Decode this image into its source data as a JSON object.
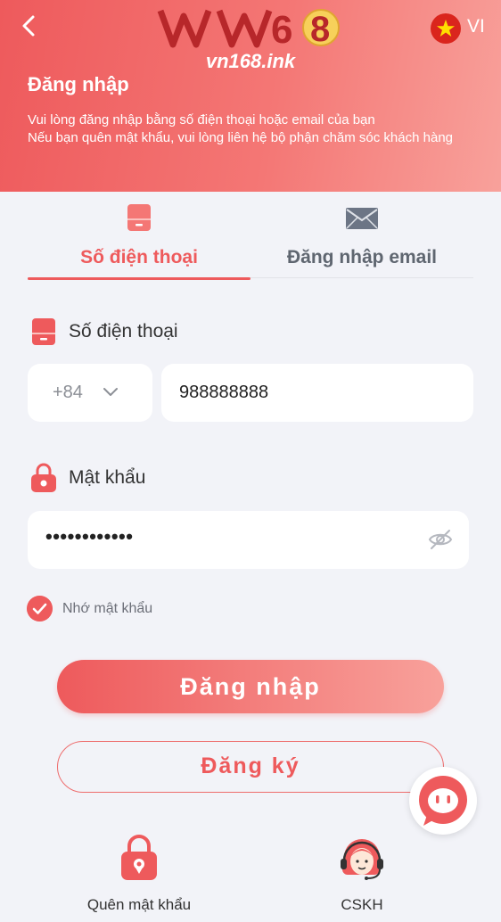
{
  "header": {
    "logo_text": "VN168",
    "logo_subtitle": "vn168.ink",
    "language": "VI",
    "title": "Đăng nhập",
    "description_line1": "Vui lòng đăng nhập bằng số điện thoại hoặc email của bạn",
    "description_line2": "Nếu bạn quên mật khẩu, vui lòng liên hệ bộ phận chăm sóc khách hàng"
  },
  "tabs": [
    {
      "label": "Số điện thoại",
      "active": true
    },
    {
      "label": "Đăng nhập email",
      "active": false
    }
  ],
  "phone_field": {
    "label": "Số điện thoại",
    "country_code": "+84",
    "value": "988888888"
  },
  "password_field": {
    "label": "Mật khẩu",
    "masked_value": "••••••••••••"
  },
  "remember": {
    "label": "Nhớ mật khẩu",
    "checked": true
  },
  "buttons": {
    "login": "Đăng nhập",
    "register": "Đăng ký"
  },
  "bottom": {
    "forgot_label": "Quên mật khẩu",
    "support_label": "CSKH"
  },
  "colors": {
    "accent": "#ee5a5c",
    "accent_light": "#f8a19b",
    "background": "#f2f3f8"
  }
}
